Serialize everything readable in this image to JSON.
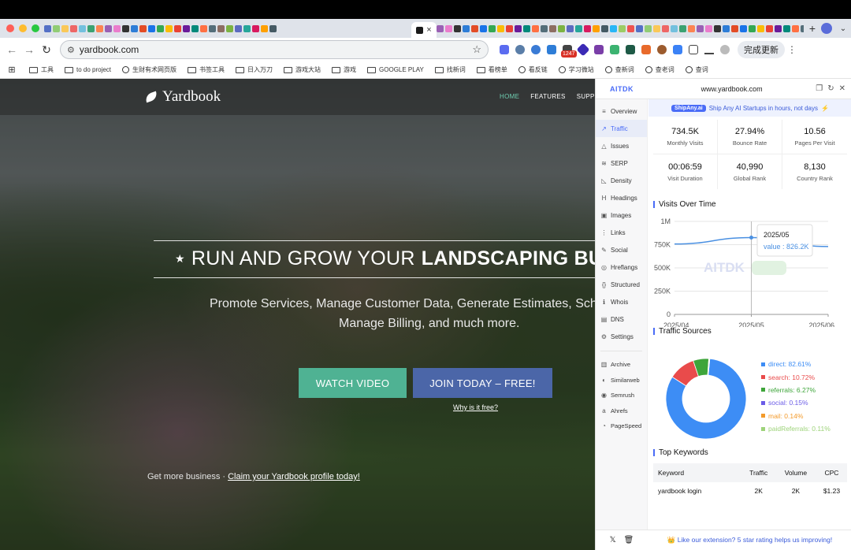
{
  "browser": {
    "active_tab_close": "×",
    "new_tab": "+",
    "url": "yardbook.com",
    "ext_badge": "1247",
    "update_label": "完成更新",
    "bookmarks": [
      "工具",
      "to do project",
      "生财有术网页版",
      "书签工具",
      "日入万刀",
      "游戏大站",
      "游戏",
      "GOOGLE PLAY",
      "找新词",
      "看榜单",
      "看反链",
      "学习微站",
      "查新词",
      "查老词",
      "查词"
    ],
    "favicon_colors": [
      "#5470c6",
      "#91cc75",
      "#fac858",
      "#ee6666",
      "#73c0de",
      "#3ba272",
      "#fc8452",
      "#9a60b4",
      "#ea7ccc",
      "#333333",
      "#2e7dd7",
      "#e34c26",
      "#1a73e8",
      "#34a853",
      "#fbbc05",
      "#ea4335",
      "#6a1b9a",
      "#00897b",
      "#ff7043",
      "#546e7a",
      "#8d6e63",
      "#7cb342",
      "#5c6bc0",
      "#26a69a",
      "#d81b60",
      "#ffa000",
      "#455a64",
      "#29b6f6",
      "#9ccc65",
      "#ef5350"
    ]
  },
  "site": {
    "logo": "Yardbook",
    "menu": [
      "HOME",
      "FEATURES",
      "SUPP"
    ],
    "headline_plain": "RUN AND GROW YOUR ",
    "headline_bold": "LANDSCAPING BUS",
    "sub_line1": "Promote Services, Manage Customer Data, Generate Estimates, Schedu",
    "sub_line2": "Manage Billing, and much more.",
    "watch_video": "WATCH VIDEO",
    "join_today": "JOIN TODAY – FREE!",
    "why_free": "Why is it free?",
    "get_more": "Get more business · ",
    "claim": "Claim your Yardbook profile today!"
  },
  "panel": {
    "brand": "AITDK",
    "domain": "www.yardbook.com",
    "promo_tag": "ShipAny.ai",
    "promo_text": "Ship Any AI Startups in hours, not days",
    "sidebar": [
      {
        "label": "Overview",
        "icon": "≡"
      },
      {
        "label": "Traffic",
        "icon": "↗",
        "active": true
      },
      {
        "label": "Issues",
        "icon": "△"
      },
      {
        "label": "SERP",
        "icon": "≋"
      },
      {
        "label": "Density",
        "icon": "◺"
      },
      {
        "label": "Headings",
        "icon": "H"
      },
      {
        "label": "Images",
        "icon": "▣"
      },
      {
        "label": "Links",
        "icon": "⋮"
      },
      {
        "label": "Social",
        "icon": "✎"
      },
      {
        "label": "Hreflangs",
        "icon": "◎"
      },
      {
        "label": "Structured",
        "icon": "{}"
      },
      {
        "label": "Whois",
        "icon": "ℹ"
      },
      {
        "label": "DNS",
        "icon": "▤"
      },
      {
        "label": "Settings",
        "icon": "⚙"
      }
    ],
    "external_tools": [
      {
        "label": "Archive",
        "icon": "▥"
      },
      {
        "label": "Similarweb",
        "icon": "◐"
      },
      {
        "label": "Semrush",
        "icon": "◉"
      },
      {
        "label": "Ahrefs",
        "icon": "a"
      },
      {
        "label": "PageSpeed",
        "icon": "◔"
      }
    ],
    "stats": [
      {
        "value": "734.5K",
        "label": "Monthly Visits"
      },
      {
        "value": "27.94%",
        "label": "Bounce Rate"
      },
      {
        "value": "10.56",
        "label": "Pages Per Visit"
      },
      {
        "value": "00:06:59",
        "label": "Visit Duration"
      },
      {
        "value": "40,990",
        "label": "Global Rank"
      },
      {
        "value": "8,130",
        "label": "Country Rank"
      }
    ],
    "visits_title": "Visits Over Time",
    "sources_title": "Traffic Sources",
    "keywords_title": "Top Keywords",
    "tooltip_date": "2025/05",
    "tooltip_value": "value : 826.2K",
    "watermark": "AITDK",
    "keywords": {
      "headers": [
        "Keyword",
        "Traffic",
        "Volume",
        "CPC"
      ],
      "rows": [
        [
          "yardbook login",
          "2K",
          "2K",
          "$1.23"
        ]
      ]
    },
    "footer_icons": [
      "x-icon",
      "trash-icon"
    ],
    "footer_msg": "👑 Like our extension? 5 star rating helps us improving!"
  },
  "chart_data": [
    {
      "type": "line",
      "title": "Visits Over Time",
      "x": [
        "2025/04",
        "2025/05",
        "2025/06"
      ],
      "series": [
        {
          "values": [
            757000,
            826200,
            730000
          ]
        }
      ],
      "yticks": [
        "0",
        "250K",
        "500K",
        "750K",
        "1M"
      ],
      "ylim": [
        0,
        1000000
      ],
      "grid": true,
      "color": "#4a90e2"
    },
    {
      "type": "pie",
      "title": "Traffic Sources",
      "labels": [
        "direct",
        "search",
        "referrals",
        "social",
        "mail",
        "paidReferrals"
      ],
      "values": [
        82.61,
        10.72,
        6.27,
        0.15,
        0.14,
        0.11
      ],
      "legend": [
        "direct: 82.61%",
        "search: 10.72%",
        "referrals: 6.27%",
        "social: 0.15%",
        "mail: 0.14%",
        "paidReferrals: 0.11%"
      ],
      "colors": [
        "#3d8df5",
        "#e94b4b",
        "#3ea53a",
        "#6b5ce7",
        "#f39a2b",
        "#9ed37a"
      ],
      "legend_position": "right"
    }
  ]
}
